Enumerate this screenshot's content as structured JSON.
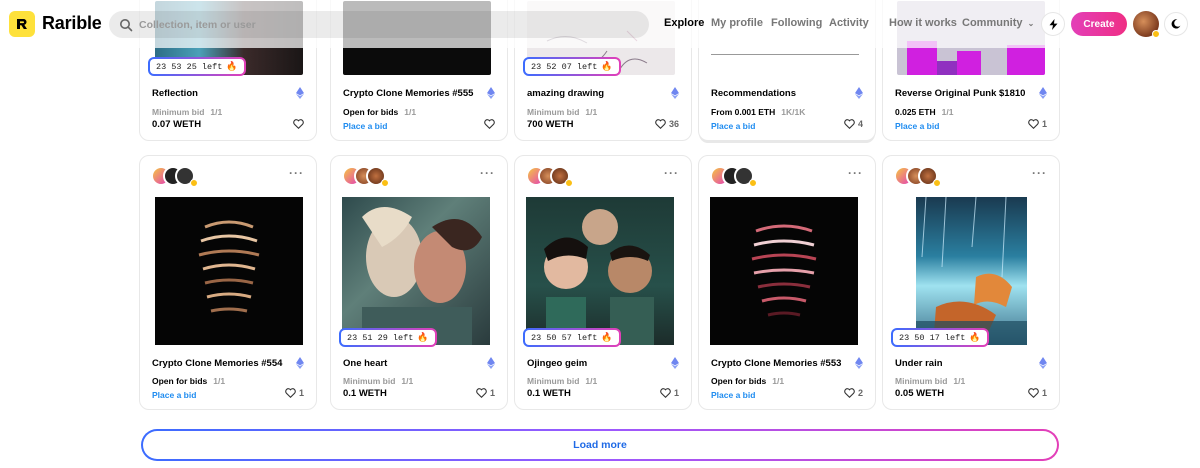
{
  "header": {
    "brand": "Rarible",
    "search_placeholder": "Collection, item or user",
    "nav": [
      "Explore",
      "My profile",
      "Following",
      "Activity",
      "How it works",
      "Community"
    ],
    "create_label": "Create"
  },
  "top_row": [
    {
      "timer": "23  53  25  left",
      "title": "Reflection",
      "line1": "Minimum bid",
      "qty": "1/1",
      "line2": "0.07 WETH",
      "place_bid": "",
      "likes": ""
    },
    {
      "timer": "",
      "title": "Crypto Clone Memories #555",
      "line1": "Open for bids",
      "qty": "1/1",
      "line2": "",
      "place_bid": "Place a bid",
      "likes": ""
    },
    {
      "timer": "23  52  07  left",
      "title": "amazing drawing",
      "line1": "Minimum bid",
      "qty": "1/1",
      "line2": "700 WETH",
      "place_bid": "",
      "likes": "36"
    },
    {
      "timer": "",
      "title": "Recommendations",
      "line1": "From 0.001 ETH",
      "qty": "1K/1K",
      "line2": "",
      "place_bid": "Place a bid",
      "likes": "4"
    },
    {
      "timer": "",
      "title": "Reverse Original Punk $1810",
      "line1": "0.025 ETH",
      "qty": "1/1",
      "line2": "",
      "place_bid": "Place a bid",
      "likes": "1"
    }
  ],
  "bottom_row": [
    {
      "timer": "",
      "title": "Crypto Clone Memories #554",
      "line1": "Open for bids",
      "qty": "1/1",
      "line2": "",
      "place_bid": "Place a bid",
      "likes": "1"
    },
    {
      "timer": "23  51  29  left",
      "title": "One heart",
      "line1": "Minimum bid",
      "qty": "1/1",
      "line2": "0.1 WETH",
      "place_bid": "",
      "likes": "1"
    },
    {
      "timer": "23  50  57  left",
      "title": "Ojingeo geim",
      "line1": "Minimum bid",
      "qty": "1/1",
      "line2": "0.1 WETH",
      "place_bid": "",
      "likes": "1"
    },
    {
      "timer": "",
      "title": "Crypto Clone Memories #553",
      "line1": "Open for bids",
      "qty": "1/1",
      "line2": "",
      "place_bid": "Place a bid",
      "likes": "2"
    },
    {
      "timer": "23  50  17  left",
      "title": "Under rain",
      "line1": "Minimum bid",
      "qty": "1/1",
      "line2": "0.05 WETH",
      "place_bid": "",
      "likes": "1"
    }
  ],
  "load_more": "Load more",
  "colors": {
    "brand_yellow": "#fee13b",
    "accent_pink": "#e33fb8",
    "link_blue": "#1f8cf0"
  }
}
